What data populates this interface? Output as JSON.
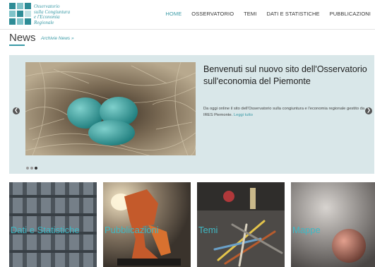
{
  "header": {
    "logo_text": [
      "Osservatorio",
      "sulla Congiuntura",
      "e l'Economia",
      "Regionale"
    ],
    "nav": [
      {
        "label": "HOME"
      },
      {
        "label": "OSSERVATORIO"
      },
      {
        "label": "TEMI"
      },
      {
        "label": "DATI E STATISTICHE"
      },
      {
        "label": "PUBBLICAZIONI"
      }
    ],
    "active_nav": "HOME",
    "accent_color": "#3a9aa6"
  },
  "news": {
    "title": "News",
    "archive_link": "Archivie News »"
  },
  "slider": {
    "title": "Benvenuti sul nuovo sito dell'Osservatorio sull'economia del Piemonte",
    "text": "Da oggi online il sito dell'Osservatorio sulla congiuntura e l'economia regionale gestito da IRES Piemonte.",
    "more": "Leggi tutto",
    "prev_icon": "chevron-left-icon",
    "next_icon": "chevron-right-icon",
    "slide_count": 3,
    "active_slide": 3
  },
  "tiles": [
    {
      "label": "Dati e Statistiche"
    },
    {
      "label": "Pubblicazioni"
    },
    {
      "label": "Temi"
    },
    {
      "label": "Mappe"
    }
  ]
}
